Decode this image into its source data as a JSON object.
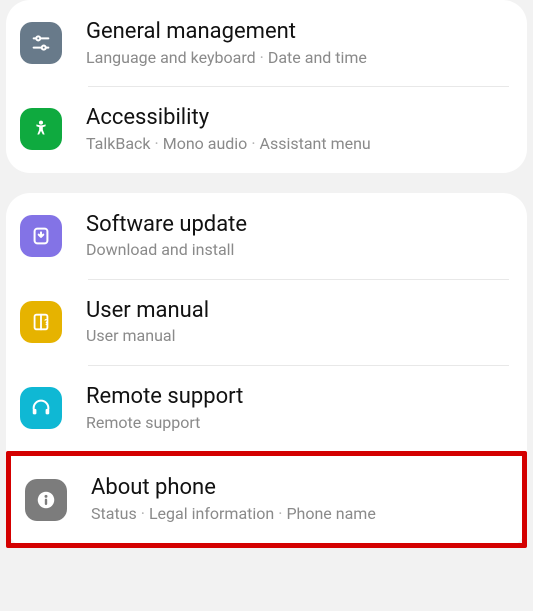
{
  "group1": {
    "general": {
      "title": "General management",
      "sub1": "Language and keyboard",
      "sub2": "Date and time"
    },
    "accessibility": {
      "title": "Accessibility",
      "sub1": "TalkBack",
      "sub2": "Mono audio",
      "sub3": "Assistant menu"
    }
  },
  "group2": {
    "software": {
      "title": "Software update",
      "sub": "Download and install"
    },
    "manual": {
      "title": "User manual",
      "sub": "User manual"
    },
    "remote": {
      "title": "Remote support",
      "sub": "Remote support"
    },
    "about": {
      "title": "About phone",
      "sub1": "Status",
      "sub2": "Legal information",
      "sub3": "Phone name"
    }
  },
  "separator": "·"
}
